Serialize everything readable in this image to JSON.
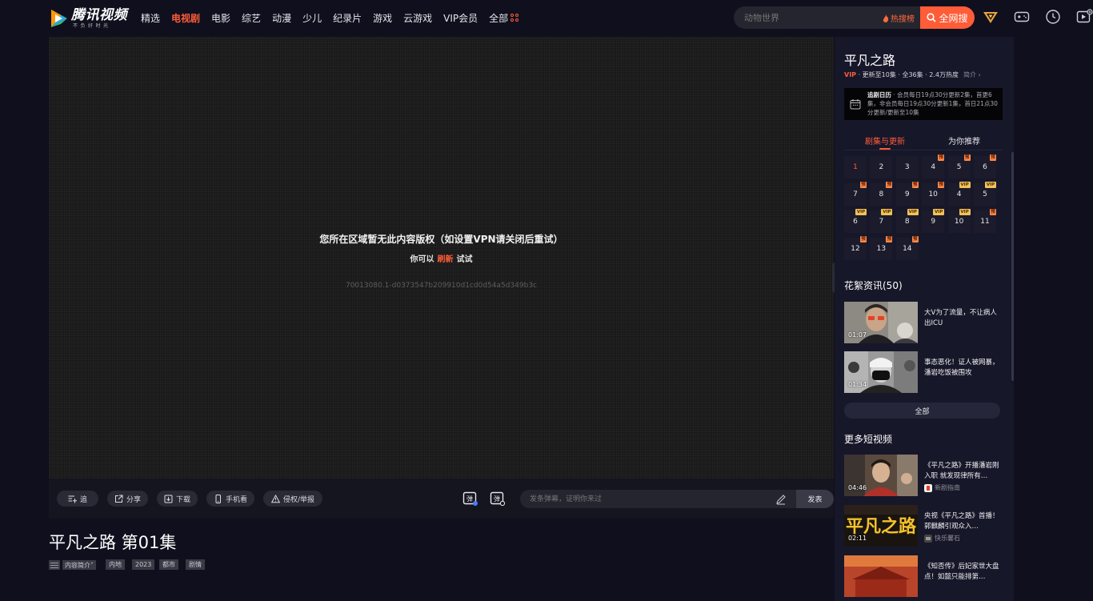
{
  "header": {
    "logo_name": "腾讯视频",
    "logo_slogan": "不负好时光",
    "nav": [
      "精选",
      "电视剧",
      "电影",
      "综艺",
      "动漫",
      "少儿",
      "纪录片",
      "游戏",
      "云游戏",
      "VIP会员"
    ],
    "nav_all": "全部",
    "active_index": 1,
    "search_placeholder": "动物世界",
    "hot_label": "热搜榜",
    "search_button": "全网搜"
  },
  "player": {
    "message": "您所在区域暂无此内容版权（如设置VPN请关闭后重试）",
    "sub_prefix": "你可以",
    "sub_link": "刷新",
    "sub_suffix": "试试",
    "error_code": "70013080.1-d0373547b209910d1cd0d54a5d349b3c"
  },
  "controls": {
    "follow": "追",
    "share": "分享",
    "download": "下载",
    "mobile": "手机看",
    "report": "侵权/举报",
    "danmu_placeholder": "发条弹幕，证明你来过",
    "send": "发表"
  },
  "episode": {
    "title": "平凡之路 第01集",
    "intro_label": "内容简介",
    "tags": [
      "内地",
      "2023",
      "都市",
      "剧情"
    ]
  },
  "sidebar": {
    "title": "平凡之路",
    "meta_vip": "VIP",
    "meta_rest": " · 更新至10集 · 全36集 · 2.4万热度",
    "brief": "简介",
    "calendar_label": "追剧日历",
    "calendar_text": " · 会员每日19点30分更新2集，首更6集，非会员每日19点30分更新1集，首日21点30分更新/更新至10集",
    "tab_episodes": "剧集与更新",
    "tab_recommend": "为你推荐",
    "episodes": [
      {
        "label": "1",
        "badge": ""
      },
      {
        "label": "2",
        "badge": ""
      },
      {
        "label": "3",
        "badge": ""
      },
      {
        "label": "4",
        "badge": "预"
      },
      {
        "label": "5",
        "badge": "预"
      },
      {
        "label": "6",
        "badge": "预"
      },
      {
        "label": "7",
        "badge": "预"
      },
      {
        "label": "8",
        "badge": "预"
      },
      {
        "label": "9",
        "badge": "预"
      },
      {
        "label": "10",
        "badge": "预"
      },
      {
        "label": "4",
        "badge": "VIP"
      },
      {
        "label": "5",
        "badge": "VIP"
      },
      {
        "label": "6",
        "badge": "VIP"
      },
      {
        "label": "7",
        "badge": "VIP"
      },
      {
        "label": "8",
        "badge": "VIP"
      },
      {
        "label": "9",
        "badge": "VIP"
      },
      {
        "label": "10",
        "badge": "VIP"
      },
      {
        "label": "11",
        "badge": "预"
      },
      {
        "label": "12",
        "badge": "预"
      },
      {
        "label": "13",
        "badge": "预"
      },
      {
        "label": "14",
        "badge": "预"
      }
    ],
    "huaxu_title": "花絮资讯(50)",
    "huaxu": [
      {
        "title": "大V为了流量，不让病人出ICU",
        "duration": "01:07"
      },
      {
        "title": "事态恶化！证人被网暴，潘岩吃饭被围攻",
        "duration": "01:34"
      }
    ],
    "all_button": "全部",
    "short_title": "更多短视频",
    "shorts": [
      {
        "title": "《平凡之路》开播潘岩刚入职 就发现律所有…",
        "duration": "04:46",
        "author": "新剧指南"
      },
      {
        "title": "央视《平凡之路》首播！郭麒麟引观众入…",
        "duration": "02:11",
        "author": "快乐馨石",
        "thumb_text": "平凡之路"
      },
      {
        "title": "《知否传》后妃家世大盘点！如懿只能排第…",
        "duration": "",
        "author": ""
      }
    ]
  }
}
